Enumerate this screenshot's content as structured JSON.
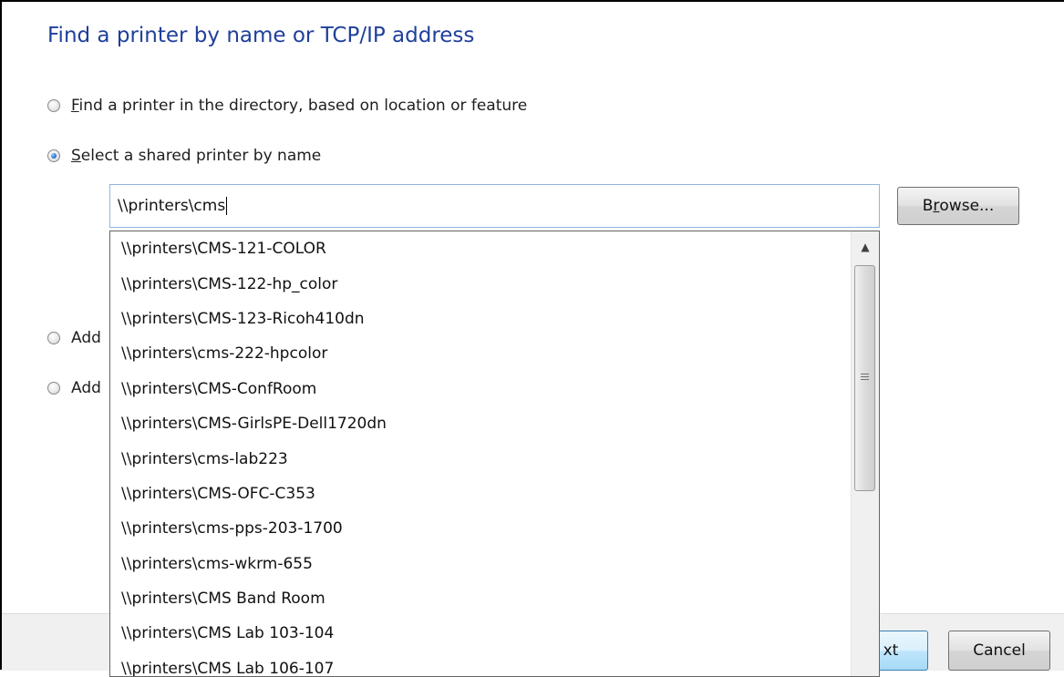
{
  "dialog": {
    "title": "Find a printer by name or TCP/IP address",
    "options": [
      {
        "label_underlined": "F",
        "label_rest": "ind a printer in the directory, based on location or feature",
        "checked": false
      },
      {
        "label_underlined": "S",
        "label_rest": "elect a shared printer by name",
        "checked": true
      },
      {
        "label_visible": "Add",
        "checked": false
      },
      {
        "label_visible": "Add",
        "checked": false
      }
    ],
    "name_input_value": "\\\\printers\\cms",
    "browse_button": {
      "before": "B",
      "underlined": "r",
      "after": "owse..."
    },
    "next_button_visible": "xt",
    "cancel_button": "Cancel"
  },
  "dropdown": {
    "items": [
      "\\\\printers\\CMS-121-COLOR",
      "\\\\printers\\CMS-122-hp_color",
      "\\\\printers\\CMS-123-Ricoh410dn",
      "\\\\printers\\cms-222-hpcolor",
      "\\\\printers\\CMS-ConfRoom",
      "\\\\printers\\CMS-GirlsPE-Dell1720dn",
      "\\\\printers\\cms-lab223",
      "\\\\printers\\CMS-OFC-C353",
      "\\\\printers\\cms-pps-203-1700",
      "\\\\printers\\cms-wkrm-655",
      "\\\\printers\\CMS Band Room",
      "\\\\printers\\CMS Lab 103-104",
      "\\\\printers\\CMS Lab 106-107"
    ],
    "scroll_up_icon": "triangle-up"
  }
}
